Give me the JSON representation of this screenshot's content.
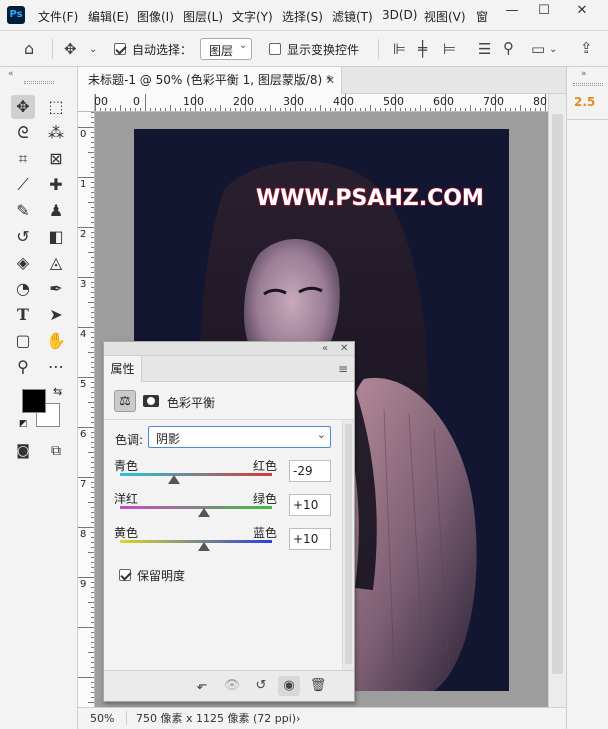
{
  "app": {
    "logo": "Ps",
    "menu": [
      "文件(F)",
      "编辑(E)",
      "图像(I)",
      "图层(L)",
      "文字(Y)",
      "选择(S)",
      "滤镜(T)",
      "3D(D)",
      "视图(V)",
      "窗"
    ]
  },
  "options": {
    "auto_select_label": "自动选择：",
    "auto_select_value": "图层",
    "transform_label": "显示变换控件"
  },
  "document": {
    "tab_title": "未标题-1 @ 50% (色彩平衡 1, 图层蒙版/8) *",
    "zoom": "50%",
    "size_info": "750 像素 x 1125 像素 (72 ppi)",
    "watermark": "WWW.PSAHZ.COM"
  },
  "ruler": {
    "top_ticks": [
      "00",
      "0",
      "100",
      "200",
      "300",
      "400",
      "500",
      "600",
      "700",
      "80"
    ],
    "left_ticks": [
      "0",
      "1",
      "2",
      "3",
      "4",
      "5",
      "6",
      "7",
      "8",
      "9"
    ]
  },
  "right_panel": {
    "value": "2.5"
  },
  "properties": {
    "tab": "属性",
    "title": "色彩平衡",
    "tone_label": "色调:",
    "tone_value": "阴影",
    "sliders": [
      {
        "left": "青色",
        "right": "红色",
        "value": "-29",
        "level": -29
      },
      {
        "left": "洋红",
        "right": "绿色",
        "value": "+10",
        "level": 10
      },
      {
        "left": "黄色",
        "right": "蓝色",
        "value": "+10",
        "level": 10
      }
    ],
    "preserve_label": "保留明度"
  },
  "colors": {
    "cyan": "#29c4d8",
    "red": "#d33a3a",
    "magenta": "#c84bc8",
    "green": "#3fbf3f",
    "yellow": "#d8d82a",
    "blue": "#2a3fd8",
    "watermark_text": "#ffffff",
    "watermark_outline": "#c8102e",
    "accent_orange": "#e58a1f"
  }
}
